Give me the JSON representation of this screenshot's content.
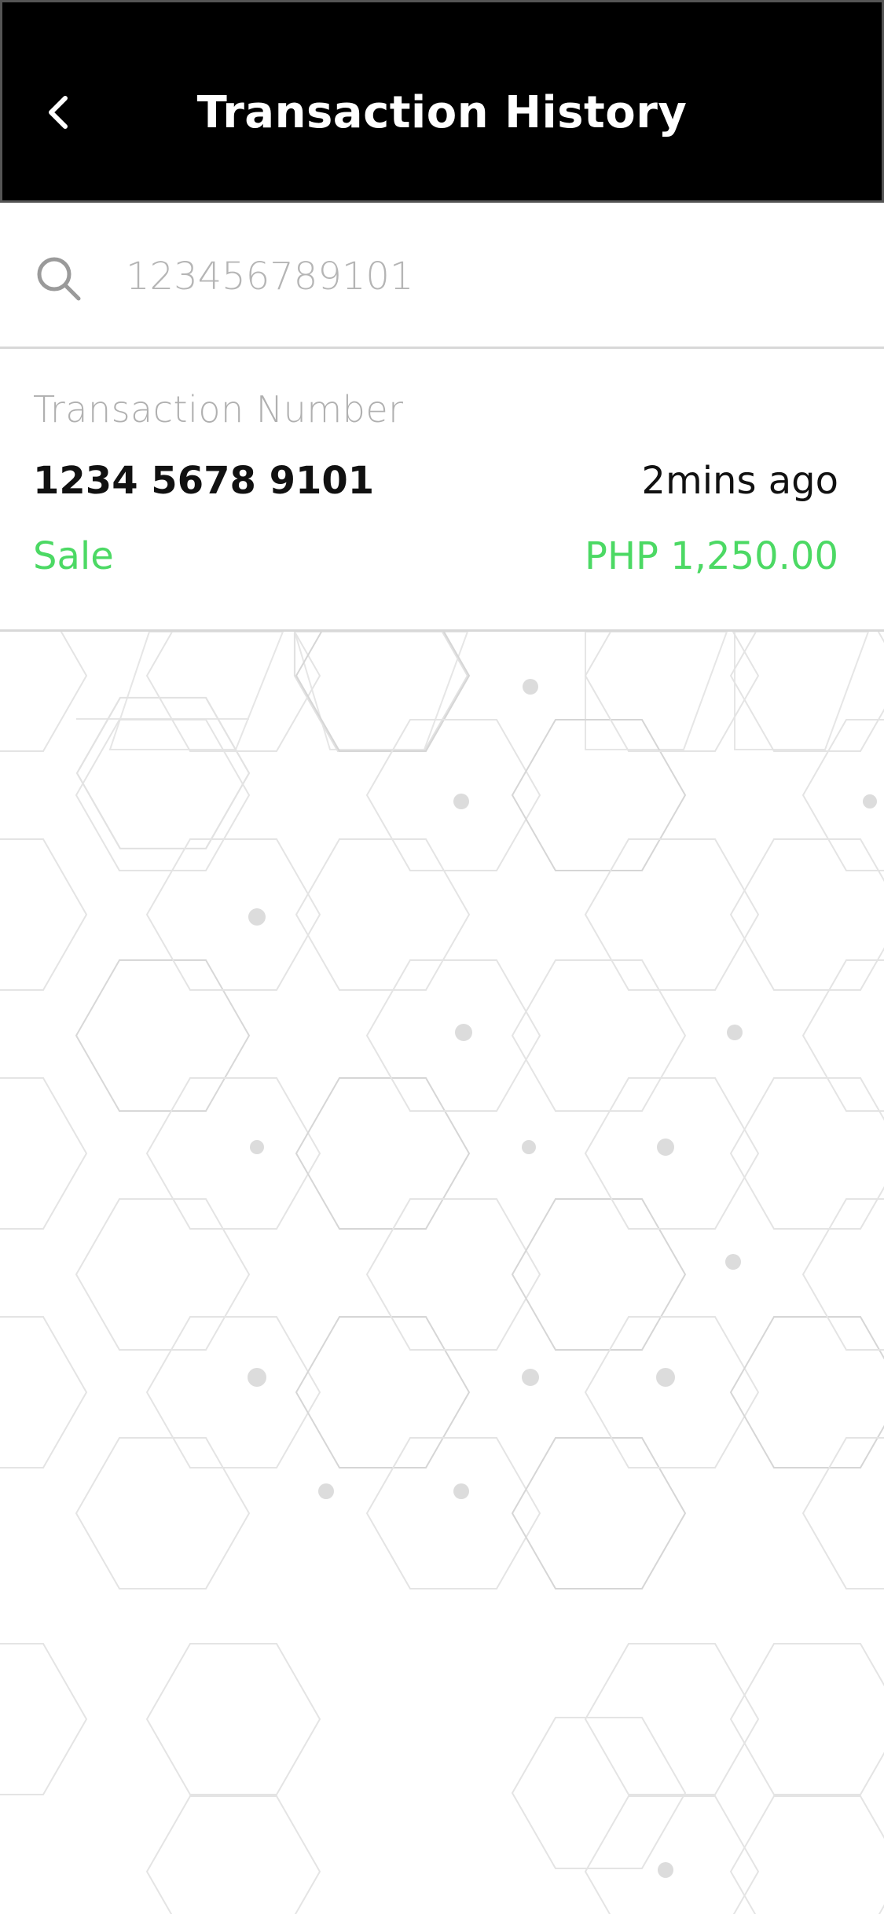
{
  "header": {
    "title": "Transaction History",
    "back_icon": "chevron-left-icon"
  },
  "search": {
    "placeholder": "123456789101",
    "value": "",
    "icon": "search-icon"
  },
  "transactions": [
    {
      "label": "Transaction Number",
      "number": "1234 5678 9101",
      "time": "2mins ago",
      "type": "Sale",
      "amount": "PHP 1,250.00"
    }
  ],
  "colors": {
    "header_bg": "#000000",
    "accent_green": "#4cd964",
    "muted_text": "#b0b0b0"
  }
}
